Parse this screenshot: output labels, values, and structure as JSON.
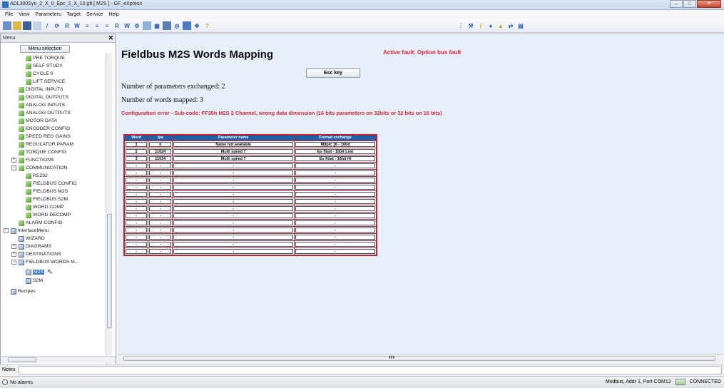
{
  "window": {
    "title": "ADL300Syn_2_X_0_Epc_2_X_10.gft [ M2S ] - GF_eXpress"
  },
  "menubar": [
    "File",
    "View",
    "Parameters",
    "Target",
    "Service",
    "Help"
  ],
  "toolbar": {
    "left_icons": [
      "new-icon",
      "open-icon",
      "save-icon",
      "copy-icon",
      "edit-icon",
      "refresh-icon",
      "r-icon",
      "w-icon",
      "compare-icon",
      "compare2-icon",
      "compare3-icon",
      "read-icon",
      "write-icon",
      "config-icon",
      "monitor-icon",
      "chip-icon",
      "chart-icon",
      "graph-icon",
      "device-icon",
      "nav-icon",
      "help-icon"
    ],
    "right_icons": [
      "grid-icon",
      "settings-icon",
      "wand-icon",
      "record-icon",
      "warning-icon",
      "transfer-icon",
      "table-icon"
    ]
  },
  "left_panel": {
    "header": "Menu",
    "menu_selection_label": "Menu selection",
    "tree": [
      {
        "label": "PRE TORQUE"
      },
      {
        "label": "SELF STUDY"
      },
      {
        "label": "CYCLE 0"
      },
      {
        "label": "LIFT SERVICE"
      },
      {
        "label": "DIGITAL INPUTS"
      },
      {
        "label": "DIGITAL OUTPUTS"
      },
      {
        "label": "ANALOG INPUTS"
      },
      {
        "label": "ANALOG OUTPUTS"
      },
      {
        "label": "MOTOR DATA"
      },
      {
        "label": "ENCODER CONFIG"
      },
      {
        "label": "SPEED REG GAINS"
      },
      {
        "label": "REGULATOR PARAM"
      },
      {
        "label": "TORQUE CONFIG"
      },
      {
        "label": "FUNCTIONS"
      },
      {
        "label": "COMMUNICATION"
      },
      {
        "label": "RS232"
      },
      {
        "label": "FIELDBUS CONFIG"
      },
      {
        "label": "FIELDBUS M2S"
      },
      {
        "label": "FIELDBUS S2M"
      },
      {
        "label": "WORD COMP"
      },
      {
        "label": "WORD DECOMP"
      },
      {
        "label": "ALARM CONFIG"
      },
      {
        "label": "InterfaceMenu"
      },
      {
        "label": "WIZARD"
      },
      {
        "label": "DIAGRAMS"
      },
      {
        "label": "DESTINATIONS"
      },
      {
        "label": "FIELDBUS WORDS M..."
      },
      {
        "label": "M2S"
      },
      {
        "label": "S2M"
      },
      {
        "label": "Recipes"
      }
    ]
  },
  "main": {
    "title": "Fieldbus M2S Words Mapping",
    "active_fault": "Active fault: Option bus fault",
    "esc_button": "Esc key",
    "params_exchanged": "Number of parameters exchanged: 2",
    "words_mapped": "Number of words mapped: 3",
    "config_error": "Configuration error - Sub-code: FF35h M2S 2 Channel, wrong data dimension (16 bits parameters on 32bits or 32 bits on 16 bits)",
    "table": {
      "headers": [
        "Word",
        "Ipa",
        "Parameter name",
        "Format exchange"
      ],
      "rows": [
        [
          "1",
          "0",
          "Name not available",
          "Mdplc 16 - 16bit"
        ],
        [
          "2",
          "11024",
          "Multi speed 7",
          "Eu float - 16bit Low"
        ],
        [
          "3",
          "11034",
          "Multi speed 7",
          "Eu float - 16bit Hi"
        ],
        [
          "-",
          "-",
          "-",
          "-"
        ],
        [
          "-",
          "-",
          "-",
          "-"
        ],
        [
          "-",
          "-",
          "-",
          "-"
        ],
        [
          "-",
          "-",
          "-",
          "-"
        ],
        [
          "-",
          "-",
          "-",
          "-"
        ],
        [
          "-",
          "-",
          "-",
          "-"
        ],
        [
          "-",
          "-",
          "-",
          "-"
        ],
        [
          "-",
          "-",
          "-",
          "-"
        ],
        [
          "-",
          "-",
          "-",
          "-"
        ],
        [
          "-",
          "-",
          "-",
          "-"
        ],
        [
          "-",
          "-",
          "-",
          "-"
        ],
        [
          "-",
          "-",
          "-",
          "-"
        ],
        [
          "-",
          "-",
          "-",
          "-"
        ]
      ]
    }
  },
  "notes_label": "Notes",
  "status": {
    "alarms": "No alarms",
    "connection_info": "Modbus, Addr 1, Port COM12",
    "connection_state": "CONNECTED"
  },
  "colors": {
    "fault_red": "#e0263a",
    "table_header_blue": "#1f5fa8",
    "main_bg": "#e6eef7"
  }
}
